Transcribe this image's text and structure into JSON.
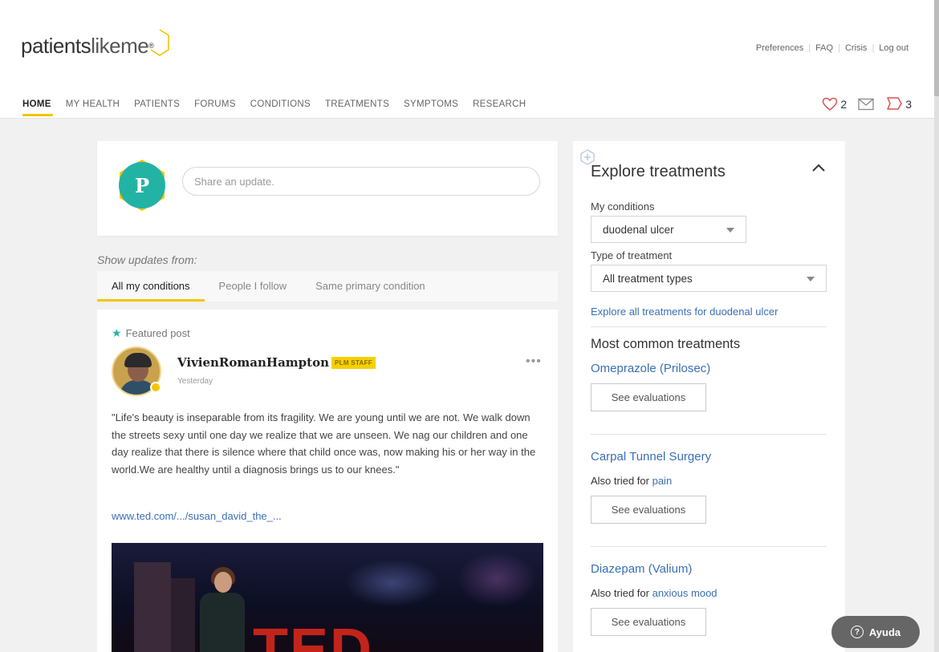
{
  "brand": {
    "name_main": "patients",
    "name_accent": "likeme",
    "registered": "®"
  },
  "utility_links": [
    "Preferences",
    "FAQ",
    "Crisis",
    "Log out"
  ],
  "nav": {
    "items": [
      "HOME",
      "MY HEALTH",
      "PATIENTS",
      "FORUMS",
      "CONDITIONS",
      "TREATMENTS",
      "SYMPTOMS",
      "RESEARCH"
    ],
    "active": "HOME",
    "heart_count": "2",
    "chat_count": "3",
    "icons": [
      "heart-icon",
      "mail-icon",
      "chat-bubble-icon"
    ]
  },
  "share": {
    "avatar_letter": "P",
    "placeholder": "Share an update.",
    "avatar_color": "#22b3a5"
  },
  "feed": {
    "show_updates_label": "Show updates from:",
    "tabs": [
      "All my conditions",
      "People I follow",
      "Same primary condition"
    ],
    "active_tab": "All my conditions"
  },
  "post": {
    "featured_label": "Featured post",
    "author": "VivienRomanHampton",
    "badge": "PLM STAFF",
    "time": "Yesterday",
    "more": "•••",
    "body": "\"Life's beauty is inseparable from its fragility. We are young until we are not. We walk down the streets sexy until one day we realize that we are unseen. We nag our children and one day realize that there is silence where that child once was, now making his or her way in the world.We are healthy until a diagnosis brings us to our knees.\"",
    "link": "www.ted.com/.../susan_david_the_...",
    "image_text": "TED"
  },
  "explore": {
    "title": "Explore treatments",
    "conditions_label": "My conditions",
    "condition_value": "duodenal ulcer",
    "type_label": "Type of treatment",
    "type_value": "All treatment types",
    "explore_all_link": "Explore all treatments for duodenal ulcer",
    "common_heading": "Most common treatments",
    "treatments": [
      {
        "name": "Omeprazole (Prilosec)",
        "also_tried_prefix": "",
        "also_tried_for": "",
        "button": "See evaluations"
      },
      {
        "name": "Carpal Tunnel Surgery",
        "also_tried_prefix": "Also tried for ",
        "also_tried_for": "pain",
        "button": "See evaluations"
      },
      {
        "name": "Diazepam (Valium)",
        "also_tried_prefix": "Also tried for ",
        "also_tried_for": "anxious mood",
        "button": "See evaluations"
      }
    ]
  },
  "help": {
    "label": "Ayuda",
    "icon": "?"
  },
  "colors": {
    "accent_yellow": "#f5c400",
    "link_blue": "#3b6fb6",
    "teal": "#22b3a5",
    "ted_red": "#c2241b"
  }
}
